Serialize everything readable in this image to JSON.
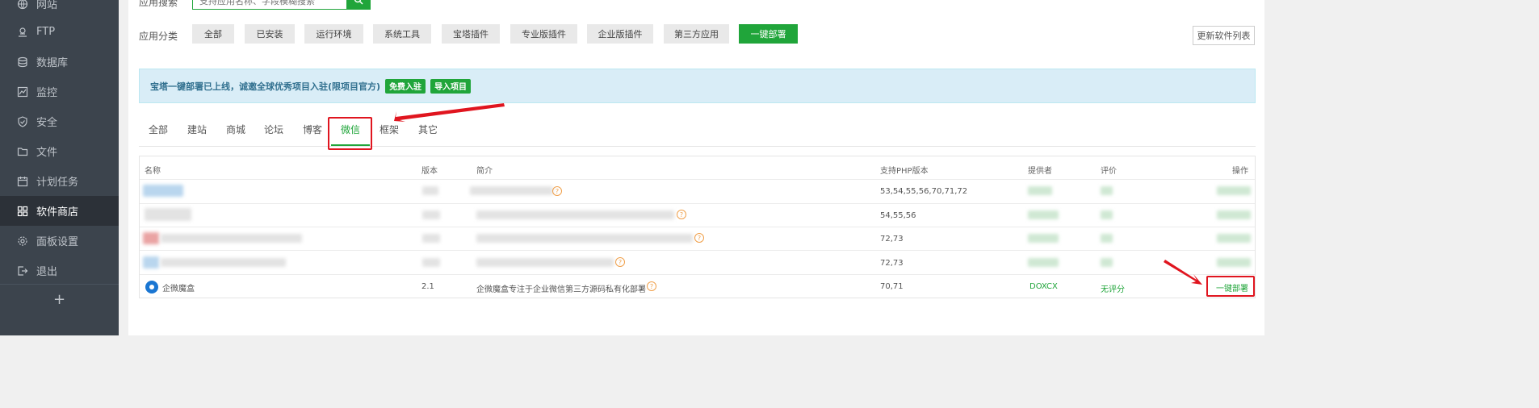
{
  "sidebar": {
    "items": [
      {
        "label": "网站",
        "icon": "globe-icon"
      },
      {
        "label": "FTP",
        "icon": "ftp-icon"
      },
      {
        "label": "数据库",
        "icon": "database-icon"
      },
      {
        "label": "监控",
        "icon": "monitor-icon"
      },
      {
        "label": "安全",
        "icon": "shield-icon"
      },
      {
        "label": "文件",
        "icon": "folder-icon"
      },
      {
        "label": "计划任务",
        "icon": "calendar-icon"
      },
      {
        "label": "软件商店",
        "icon": "grid-icon",
        "active": true
      },
      {
        "label": "面板设置",
        "icon": "gear-icon"
      },
      {
        "label": "退出",
        "icon": "logout-icon"
      }
    ],
    "add": "+"
  },
  "search": {
    "label": "应用搜索",
    "placeholder": "支持应用名称、字段模糊搜索"
  },
  "category": {
    "label": "应用分类",
    "items": [
      "全部",
      "已安装",
      "运行环境",
      "系统工具",
      "宝塔插件",
      "专业版插件",
      "企业版插件",
      "第三方应用",
      "一键部署"
    ],
    "active": "一键部署",
    "refresh": "更新软件列表"
  },
  "notice": {
    "text": "宝塔一键部署已上线，诚邀全球优秀项目入驻(限项目官方)",
    "btn_join": "免费入驻",
    "btn_import": "导入项目"
  },
  "subtabs": {
    "items": [
      "全部",
      "建站",
      "商城",
      "论坛",
      "博客",
      "微信",
      "框架",
      "其它"
    ],
    "active": "微信"
  },
  "table": {
    "headers": [
      "名称",
      "版本",
      "简介",
      "支持PHP版本",
      "提供者",
      "评价",
      "操作"
    ],
    "rows": [
      {
        "php": "53,54,55,56,70,71,72"
      },
      {
        "php": "54,55,56"
      },
      {
        "php": "72,73"
      },
      {
        "php": "72,73"
      },
      {
        "name": "企微魔盒",
        "version": "2.1",
        "desc": "企微魔盒专注于企业微信第三方源码私有化部署",
        "php": "70,71",
        "provider": "DOXCX",
        "rating": "无评分",
        "action": "一键部署"
      }
    ]
  },
  "colors": {
    "accent": "#20a53a",
    "annotation": "#e0151f",
    "sidebar_bg": "#3c444d"
  }
}
